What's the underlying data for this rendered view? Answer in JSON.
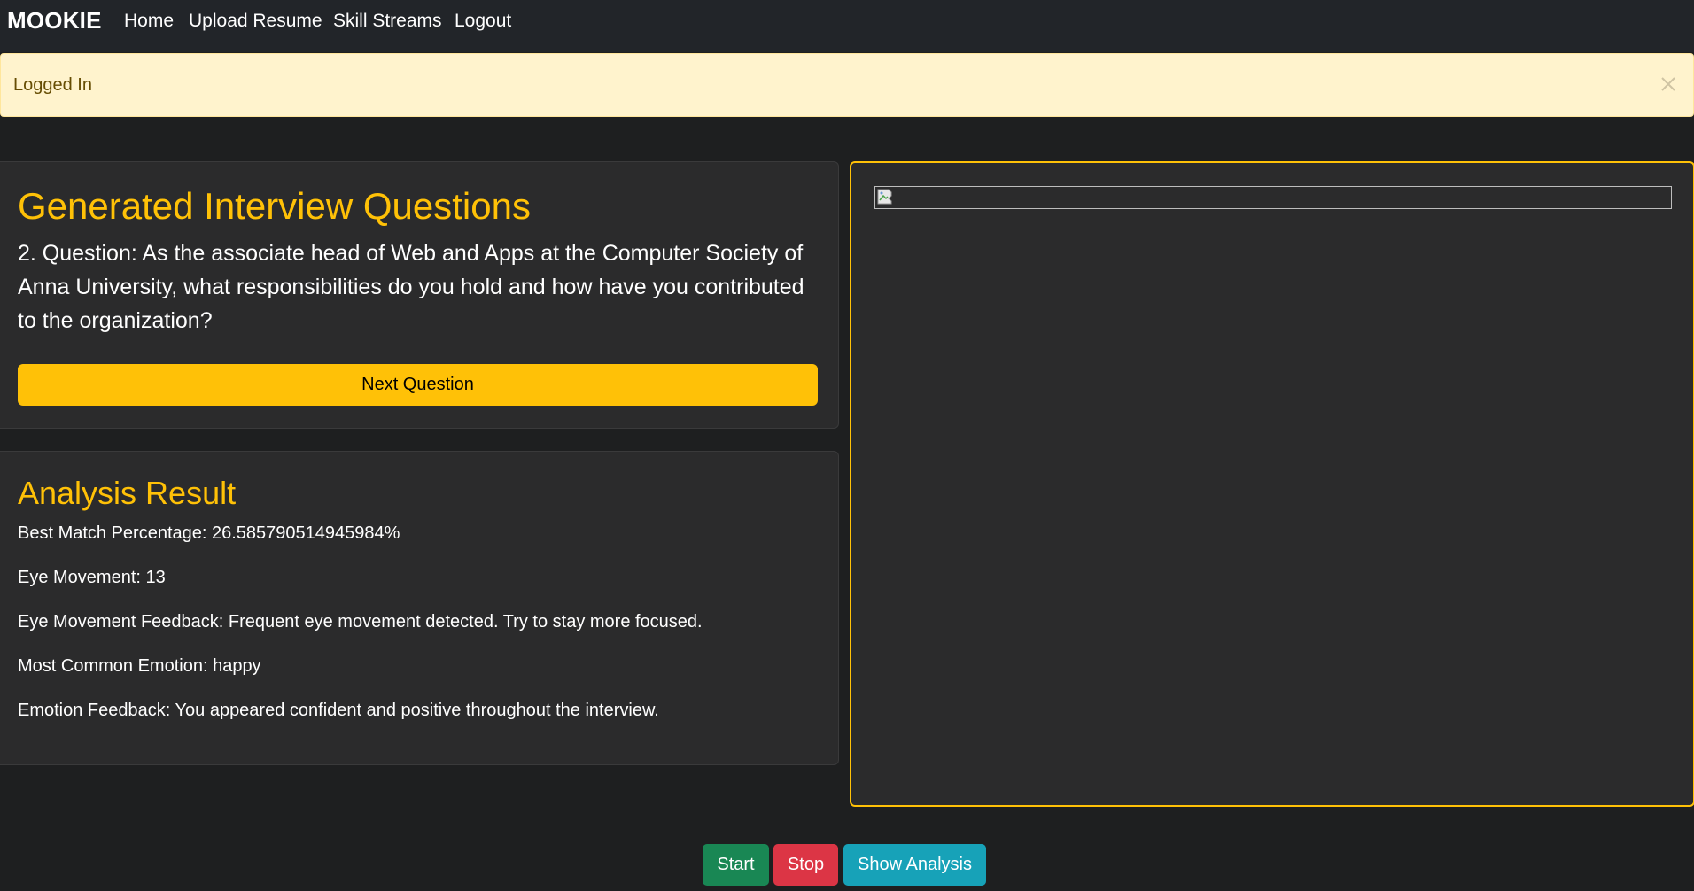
{
  "navbar": {
    "brand": "MOOKIE",
    "links": [
      "Home",
      "Upload Resume",
      "Skill Streams",
      "Logout"
    ]
  },
  "alert": {
    "message": "Logged In",
    "close_icon": "close-icon"
  },
  "questions": {
    "heading": "Generated Interview Questions",
    "question": "2. Question: As the associate head of Web and Apps at the Computer Society of Anna University, what responsibilities do you hold and how have you contributed to the organization?",
    "next_label": "Next Question"
  },
  "analysis": {
    "heading": "Analysis Result",
    "lines": [
      "Best Match Percentage: 26.585790514945984%",
      "Eye Movement: 13",
      "Eye Movement Feedback: Frequent eye movement detected. Try to stay more focused.",
      "Most Common Emotion: happy",
      "Emotion Feedback: You appeared confident and positive throughout the interview."
    ]
  },
  "video": {
    "image_icon": "broken-image-icon"
  },
  "controls": {
    "start_label": "Start",
    "stop_label": "Stop",
    "show_analysis_label": "Show Analysis"
  },
  "colors": {
    "accent": "#ffc107",
    "background": "#1e1f20",
    "card": "#2b2b2c",
    "start": "#198754",
    "stop": "#dc3545",
    "info": "#17a2b8",
    "alert_bg": "#fff3cd"
  }
}
